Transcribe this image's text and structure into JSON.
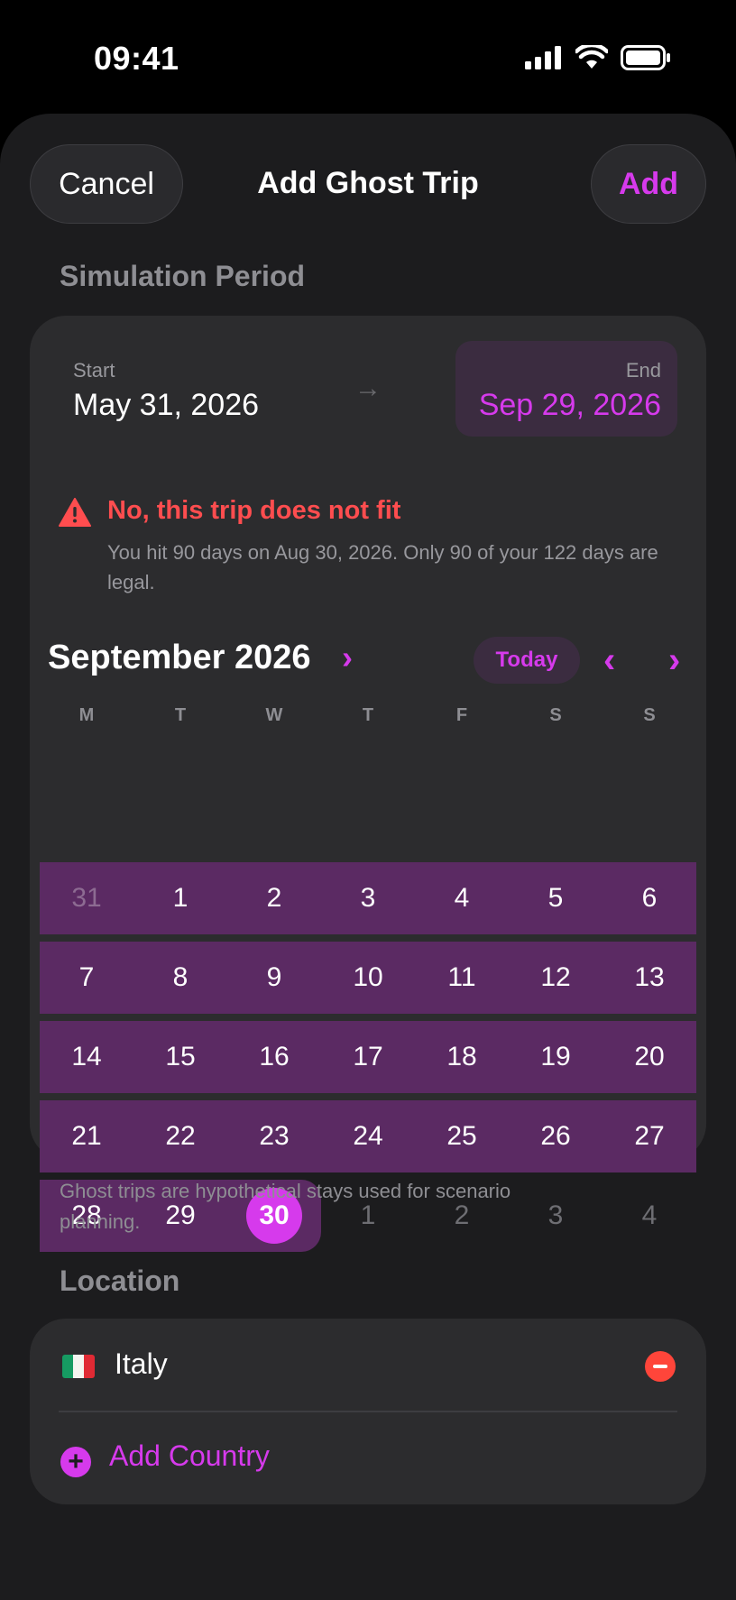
{
  "status_bar": {
    "time": "09:41"
  },
  "header": {
    "cancel_label": "Cancel",
    "title": "Add Ghost Trip",
    "add_label": "Add"
  },
  "simulation": {
    "section_title": "Simulation Period",
    "start_label": "Start",
    "start_value": "May 31, 2026",
    "arrow": "→",
    "end_label": "End",
    "end_value": "Sep 29, 2026",
    "warning_title": "No, this trip does not fit",
    "warning_text": "You hit 90 days on Aug 30, 2026. Only 90 of your 122 days are legal."
  },
  "calendar": {
    "month_title": "September 2026",
    "month_chevron": "›",
    "today_label": "Today",
    "prev": "‹",
    "next": "›",
    "weekdays": [
      "M",
      "T",
      "W",
      "T",
      "F",
      "S",
      "S"
    ],
    "weeks": [
      [
        "31",
        "1",
        "2",
        "3",
        "4",
        "5",
        "6"
      ],
      [
        "7",
        "8",
        "9",
        "10",
        "11",
        "12",
        "13"
      ],
      [
        "14",
        "15",
        "16",
        "17",
        "18",
        "19",
        "20"
      ],
      [
        "21",
        "22",
        "23",
        "24",
        "25",
        "26",
        "27"
      ],
      [
        "28",
        "29",
        "30",
        "1",
        "2",
        "3",
        "4"
      ]
    ],
    "selected_day": "30",
    "range_color": "#5b2a63",
    "accent_color": "#d63aec"
  },
  "footnote": "Ghost trips are hypothetical stays used for scenario planning.",
  "location": {
    "section_title": "Location",
    "countries": [
      {
        "name": "Italy",
        "flag_icon": "italy-flag-icon"
      }
    ],
    "remove_icon": "minus-circle-icon",
    "add_label": "Add Country",
    "add_icon": "plus-circle-icon"
  }
}
